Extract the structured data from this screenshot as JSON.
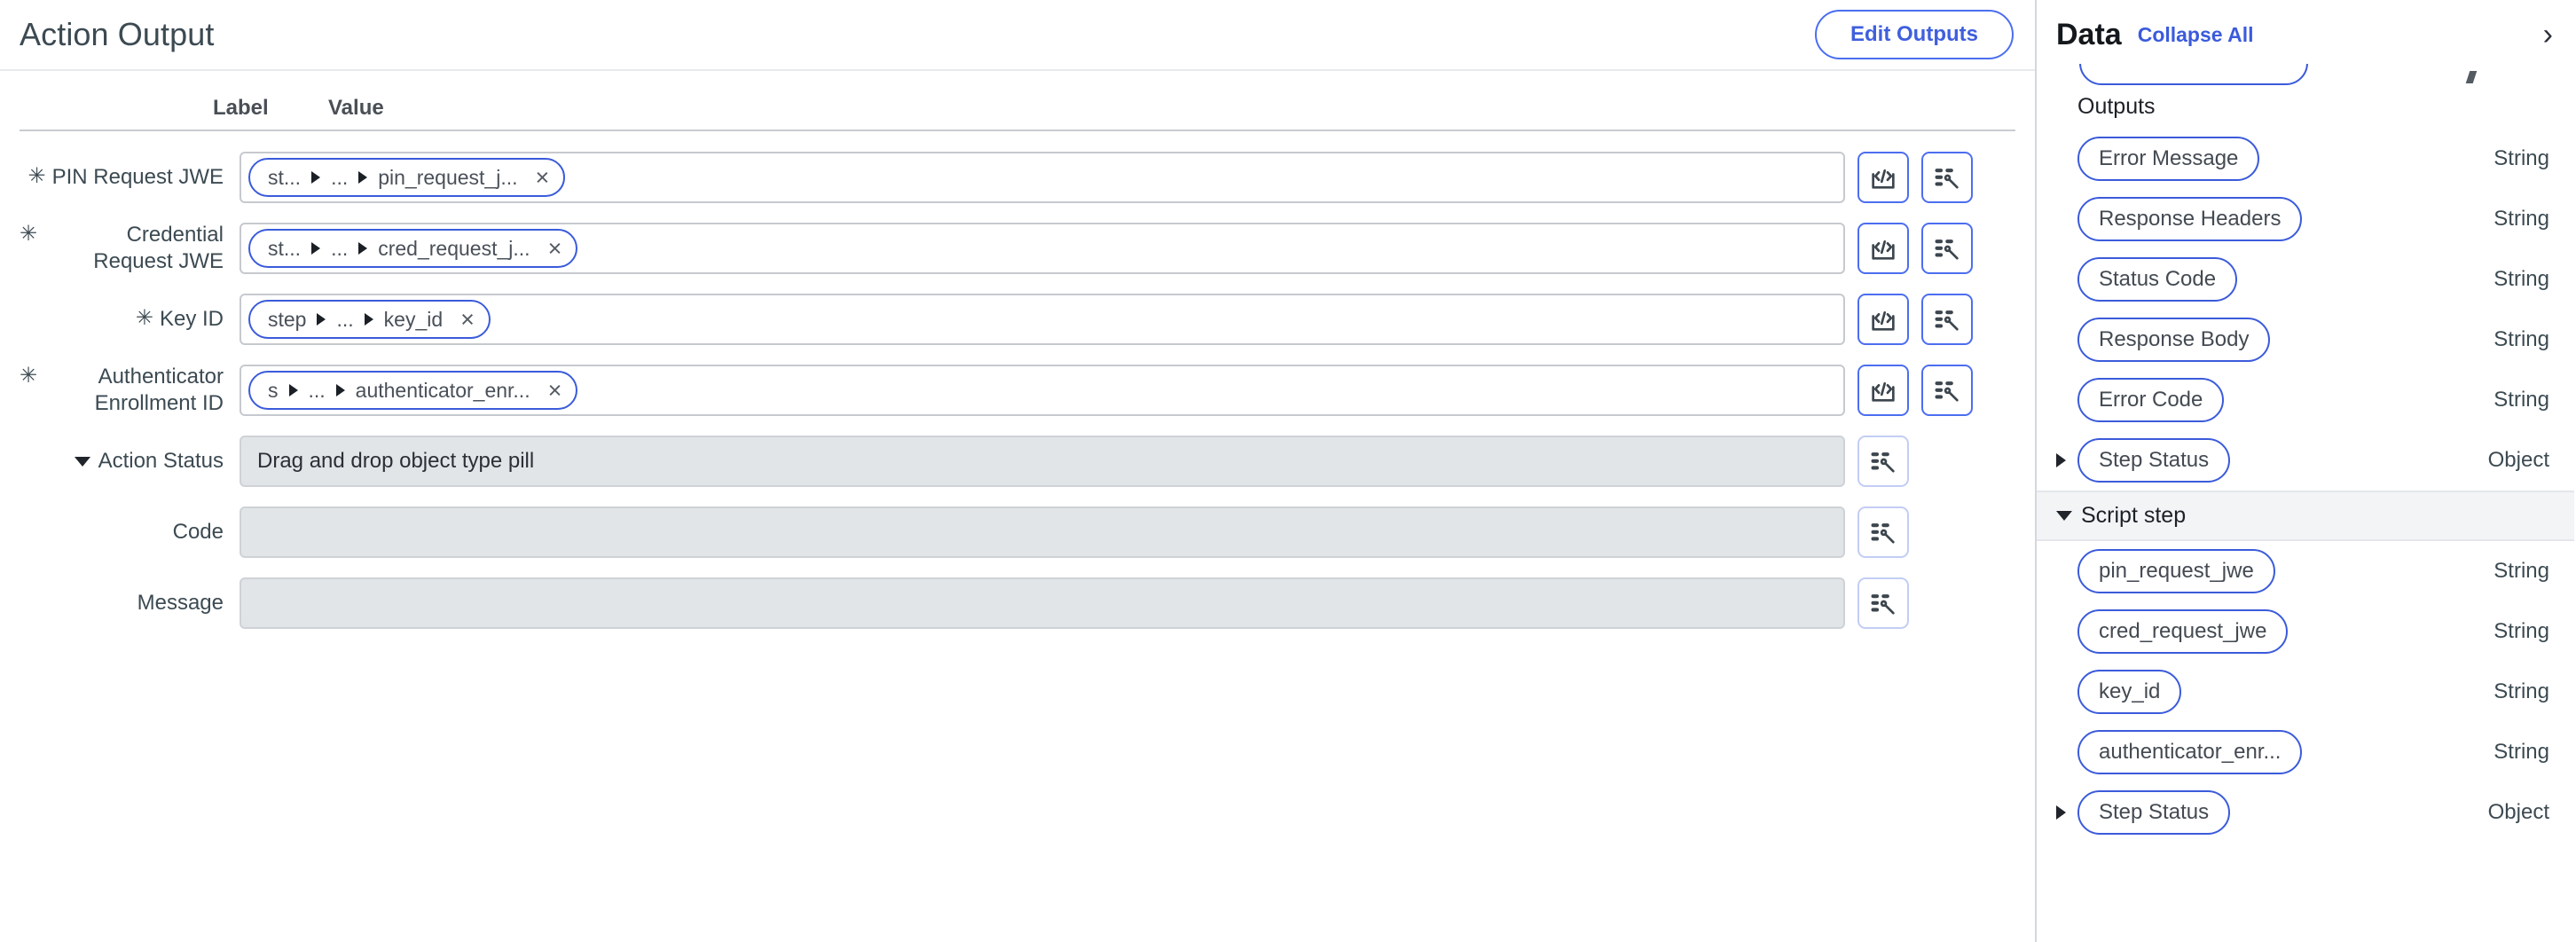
{
  "main": {
    "title": "Action Output",
    "edit_outputs_label": "Edit Outputs",
    "columns": {
      "label": "Label",
      "value": "Value"
    },
    "rows": [
      {
        "label": "PIN Request JWE",
        "required": true,
        "collapsible": false,
        "pill": {
          "first": "st...",
          "middle": "...",
          "last": "pin_request_j...",
          "remove_icon": "×"
        },
        "buttons": [
          "code-icon",
          "wand-list-icon"
        ],
        "disabled": false,
        "value_text": ""
      },
      {
        "label": "Credential Request JWE",
        "required": true,
        "collapsible": false,
        "pill": {
          "first": "st...",
          "middle": "...",
          "last": "cred_request_j...",
          "remove_icon": "×"
        },
        "buttons": [
          "code-icon",
          "wand-list-icon"
        ],
        "disabled": false,
        "value_text": ""
      },
      {
        "label": "Key ID",
        "required": true,
        "collapsible": false,
        "pill": {
          "first": "step",
          "middle": "...",
          "last": "key_id",
          "remove_icon": "×"
        },
        "buttons": [
          "code-icon",
          "wand-list-icon"
        ],
        "disabled": false,
        "value_text": ""
      },
      {
        "label": "Authenticator Enrollment ID",
        "required": true,
        "collapsible": false,
        "pill": {
          "first": "s",
          "middle": "...",
          "last": "authenticator_enr...",
          "remove_icon": "×"
        },
        "buttons": [
          "code-icon",
          "wand-list-icon"
        ],
        "disabled": false,
        "value_text": ""
      },
      {
        "label": "Action Status",
        "required": false,
        "collapsible": true,
        "pill": null,
        "buttons": [
          "wand-list-icon"
        ],
        "disabled": true,
        "value_text": "Drag and drop object type pill"
      },
      {
        "label": "Code",
        "required": false,
        "collapsible": false,
        "pill": null,
        "buttons": [
          "wand-list-icon"
        ],
        "disabled": true,
        "value_text": ""
      },
      {
        "label": "Message",
        "required": false,
        "collapsible": false,
        "pill": null,
        "buttons": [
          "wand-list-icon"
        ],
        "disabled": true,
        "value_text": ""
      }
    ]
  },
  "sidebar": {
    "title": "Data",
    "collapse_all_label": "Collapse All",
    "expand_icon": "›",
    "outputs_group_label": "Outputs",
    "outputs": [
      {
        "name": "Error Message",
        "type": "String",
        "expandable": false
      },
      {
        "name": "Response Headers",
        "type": "String",
        "expandable": false
      },
      {
        "name": "Status Code",
        "type": "String",
        "expandable": false
      },
      {
        "name": "Response Body",
        "type": "String",
        "expandable": false
      },
      {
        "name": "Error Code",
        "type": "String",
        "expandable": false
      },
      {
        "name": "Step Status",
        "type": "Object",
        "expandable": true
      }
    ],
    "script_section_label": "Script step",
    "script_items": [
      {
        "name": "pin_request_jwe",
        "type": "String",
        "expandable": false
      },
      {
        "name": "cred_request_jwe",
        "type": "String",
        "expandable": false
      },
      {
        "name": "key_id",
        "type": "String",
        "expandable": false
      },
      {
        "name": "authenticator_enr...",
        "type": "String",
        "expandable": false
      },
      {
        "name": "Step Status",
        "type": "Object",
        "expandable": true
      }
    ]
  },
  "colors": {
    "accent_blue": "#3b5bdb",
    "button_blue": "#4c6ef0",
    "text_dark": "#3c4a52",
    "disabled_field": "#e2e5e8",
    "section_bar": "#f3f4f6"
  }
}
